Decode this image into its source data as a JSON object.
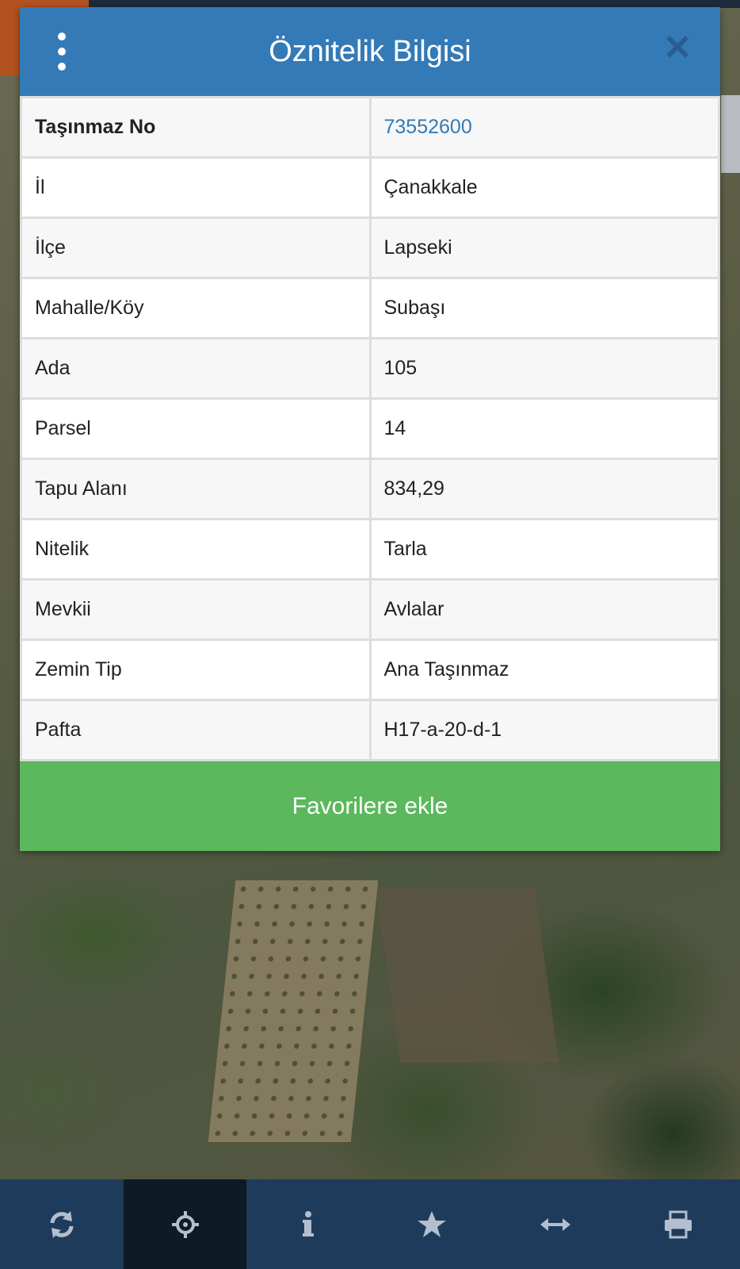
{
  "modal": {
    "title": "Öznitelik Bilgisi",
    "menu_icon": "more-vertical-icon",
    "close_icon": "close-icon",
    "rows": [
      {
        "key": "Taşınmaz No",
        "value": "73552600"
      },
      {
        "key": "İl",
        "value": "Çanakkale"
      },
      {
        "key": "İlçe",
        "value": "Lapseki"
      },
      {
        "key": "Mahalle/Köy",
        "value": "Subaşı"
      },
      {
        "key": "Ada",
        "value": "105"
      },
      {
        "key": "Parsel",
        "value": "14"
      },
      {
        "key": "Tapu Alanı",
        "value": "834,29"
      },
      {
        "key": "Nitelik",
        "value": "Tarla"
      },
      {
        "key": "Mevkii",
        "value": "Avlalar"
      },
      {
        "key": "Zemin Tip",
        "value": "Ana Taşınmaz"
      },
      {
        "key": "Pafta",
        "value": "H17-a-20-d-1"
      }
    ],
    "favorite_button": "Favorilere ekle"
  },
  "toolbar": {
    "items": [
      {
        "icon": "refresh-icon",
        "active": false
      },
      {
        "icon": "crosshair-icon",
        "active": true
      },
      {
        "icon": "info-icon",
        "active": false
      },
      {
        "icon": "star-icon",
        "active": false
      },
      {
        "icon": "measure-arrows-icon",
        "active": false
      },
      {
        "icon": "print-icon",
        "active": false
      }
    ]
  },
  "colors": {
    "header": "#337ab7",
    "link": "#337ab7",
    "favorite_button": "#5cb85c",
    "toolbar": "#1f3b5c",
    "toolbar_active": "#0e1a26"
  }
}
